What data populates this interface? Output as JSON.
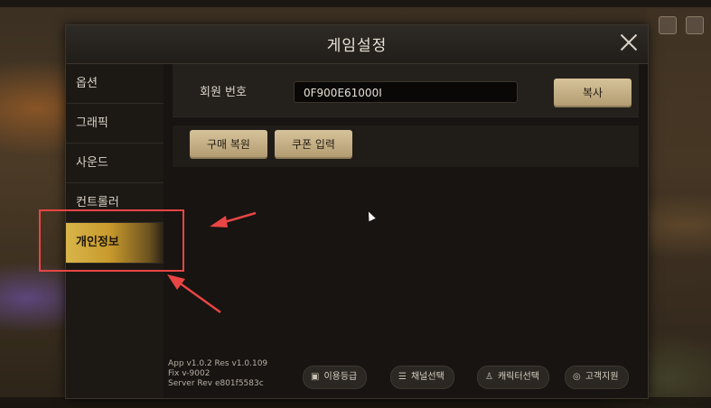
{
  "modal": {
    "title": "게임설정"
  },
  "sidebar": {
    "items": [
      {
        "label": "옵션"
      },
      {
        "label": "그래픽"
      },
      {
        "label": "사운드"
      },
      {
        "label": "컨트롤러"
      },
      {
        "label": "개인정보",
        "active": true
      }
    ]
  },
  "account": {
    "member_label": "회원 번호",
    "member_value": "0F900E61000I",
    "copy_label": "복사",
    "restore_label": "구매 복원",
    "coupon_label": "쿠폰 입력"
  },
  "version": {
    "line1": "App v1.0.2 Res v1.0.109",
    "line2": "Fix v-9002",
    "line3": "Server Rev e801f5583c"
  },
  "footer_buttons": [
    {
      "label": "이용등급",
      "icon": "gamepad-icon"
    },
    {
      "label": "채널선택",
      "icon": "list-icon"
    },
    {
      "label": "캐릭터선택",
      "icon": "character-icon"
    },
    {
      "label": "고객지원",
      "icon": "support-icon"
    }
  ],
  "annotation": {
    "highlight_color": "#e84545"
  }
}
